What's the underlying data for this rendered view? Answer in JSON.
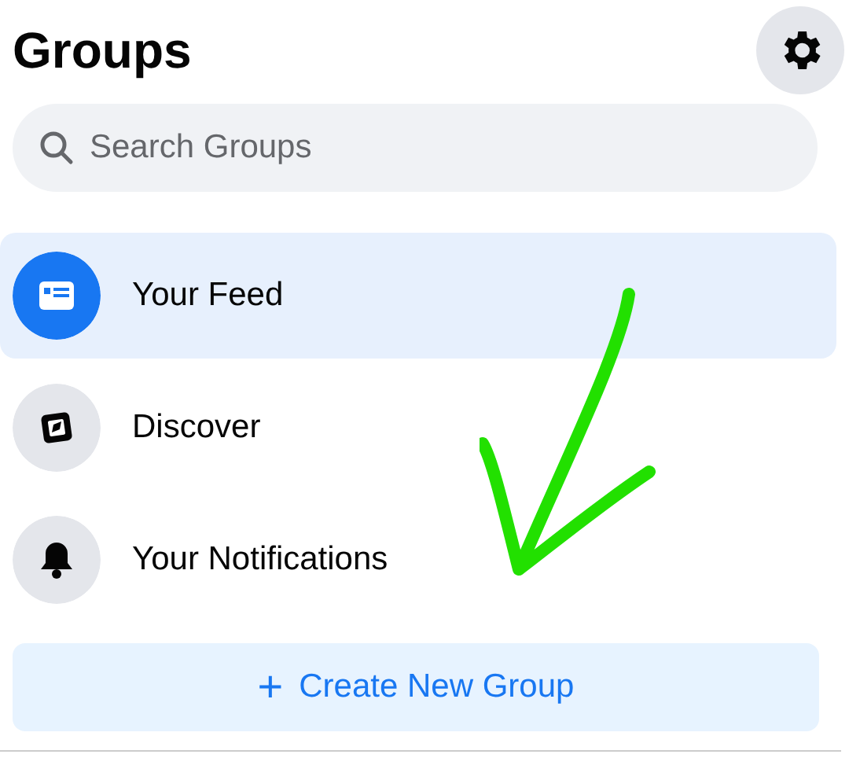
{
  "header": {
    "title": "Groups"
  },
  "search": {
    "placeholder": "Search Groups"
  },
  "nav_items": [
    {
      "label": "Your Feed",
      "selected": true,
      "kind": "feed"
    },
    {
      "label": "Discover",
      "selected": false,
      "kind": "discover"
    },
    {
      "label": "Your Notifications",
      "selected": false,
      "kind": "notifications"
    }
  ],
  "create_button": {
    "icon": "+",
    "label": "Create New Group"
  }
}
